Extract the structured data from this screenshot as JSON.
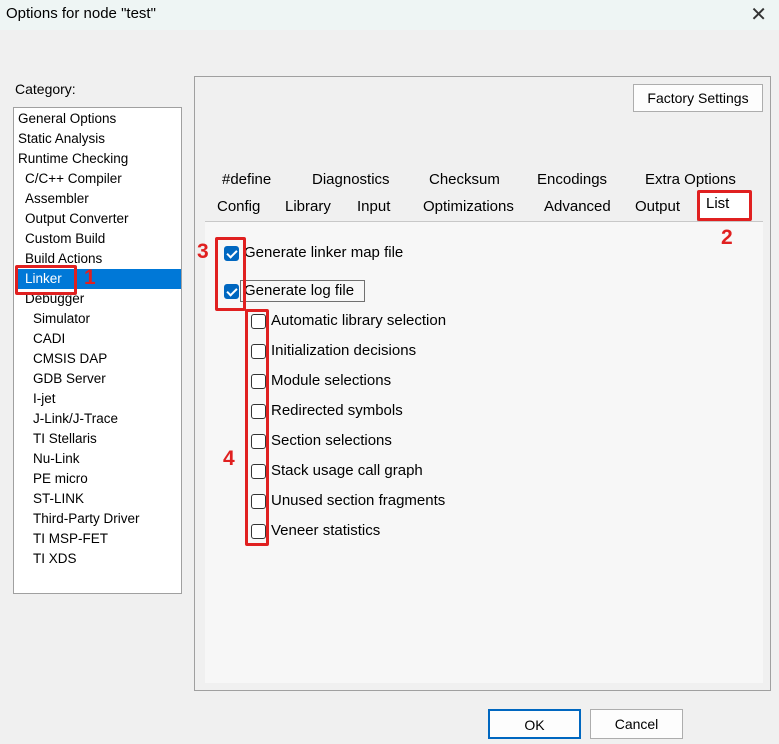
{
  "window": {
    "title": "Options for node \"test\"",
    "close_glyph": "✕"
  },
  "category": {
    "label": "Category:",
    "items": [
      {
        "label": "General Options"
      },
      {
        "label": "Static Analysis"
      },
      {
        "label": "Runtime Checking"
      },
      {
        "label": "C/C++ Compiler"
      },
      {
        "label": "Assembler"
      },
      {
        "label": "Output Converter"
      },
      {
        "label": "Custom Build"
      },
      {
        "label": "Build Actions"
      },
      {
        "label": "Linker",
        "selected": true
      },
      {
        "label": "Debugger"
      },
      {
        "label": "Simulator"
      },
      {
        "label": "CADI"
      },
      {
        "label": "CMSIS DAP"
      },
      {
        "label": "GDB Server"
      },
      {
        "label": "I-jet"
      },
      {
        "label": "J-Link/J-Trace"
      },
      {
        "label": "TI Stellaris"
      },
      {
        "label": "Nu-Link"
      },
      {
        "label": "PE micro"
      },
      {
        "label": "ST-LINK"
      },
      {
        "label": "Third-Party Driver"
      },
      {
        "label": "TI MSP-FET"
      },
      {
        "label": "TI XDS"
      }
    ]
  },
  "factory_settings_label": "Factory Settings",
  "tabs": {
    "row1": [
      "#define",
      "Diagnostics",
      "Checksum",
      "Encodings",
      "Extra Options"
    ],
    "row2": [
      "Config",
      "Library",
      "Input",
      "Optimizations",
      "Advanced",
      "Output",
      "List"
    ],
    "active": "List"
  },
  "options": {
    "generate_map": {
      "label": "Generate linker map file",
      "checked": true
    },
    "generate_log": {
      "label": "Generate log file",
      "checked": true
    },
    "log_items": [
      {
        "label": "Automatic library selection",
        "checked": false
      },
      {
        "label": "Initialization decisions",
        "checked": false
      },
      {
        "label": "Module selections",
        "checked": false
      },
      {
        "label": "Redirected symbols",
        "checked": false
      },
      {
        "label": "Section selections",
        "checked": false
      },
      {
        "label": "Stack usage call graph",
        "checked": false
      },
      {
        "label": "Unused section fragments",
        "checked": false
      },
      {
        "label": "Veneer statistics",
        "checked": false
      }
    ]
  },
  "buttons": {
    "ok": "OK",
    "cancel": "Cancel"
  },
  "annotations": {
    "n1": "1",
    "n2": "2",
    "n3": "3",
    "n4": "4",
    "color": "#e02020"
  },
  "colors": {
    "selection": "#0078d7",
    "checkbox_checked": "#0067c0"
  }
}
